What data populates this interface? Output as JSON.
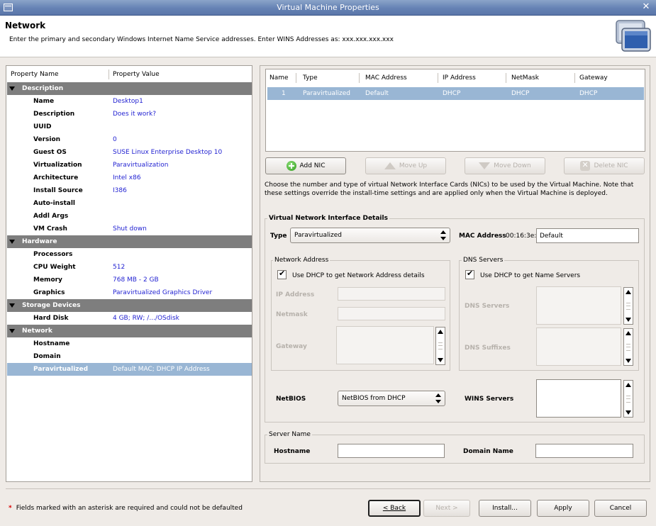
{
  "window": {
    "title": "Virtual Machine Properties"
  },
  "header": {
    "title": "Network",
    "subtitle": "Enter the primary and secondary Windows Internet Name Service addresses.  Enter WINS Addresses as: xxx.xxx.xxx.xxx"
  },
  "tree": {
    "col_name": "Property Name",
    "col_value": "Property Value",
    "rows": [
      {
        "type": "cat",
        "label": "Description"
      },
      {
        "type": "item",
        "name": "Name",
        "value": "Desktop1"
      },
      {
        "type": "item",
        "name": "Description",
        "value": "Does it work?"
      },
      {
        "type": "item",
        "name": "UUID",
        "value": ""
      },
      {
        "type": "item",
        "name": "Version",
        "value": "0"
      },
      {
        "type": "item",
        "name": "Guest OS",
        "value": "SUSE Linux Enterprise Desktop 10"
      },
      {
        "type": "item",
        "name": "Virtualization",
        "value": "Paravirtualization"
      },
      {
        "type": "item",
        "name": "Architecture",
        "value": "Intel x86"
      },
      {
        "type": "item",
        "name": "Install Source",
        "value": "I386"
      },
      {
        "type": "item",
        "name": "Auto-install",
        "value": ""
      },
      {
        "type": "item",
        "name": "Addl Args",
        "value": ""
      },
      {
        "type": "item",
        "name": "VM Crash",
        "value": "Shut down"
      },
      {
        "type": "cat",
        "label": "Hardware"
      },
      {
        "type": "item",
        "name": "Processors",
        "value": ""
      },
      {
        "type": "item",
        "name": "CPU Weight",
        "value": "512"
      },
      {
        "type": "item",
        "name": "Memory",
        "value": "768 MB - 2 GB"
      },
      {
        "type": "item",
        "name": "Graphics",
        "value": "Paravirtualized Graphics Driver"
      },
      {
        "type": "cat",
        "label": "Storage Devices"
      },
      {
        "type": "item",
        "name": "Hard Disk",
        "value": "4 GB; RW; /.../OSdisk"
      },
      {
        "type": "cat",
        "label": "Network"
      },
      {
        "type": "item",
        "name": "Hostname",
        "value": ""
      },
      {
        "type": "item",
        "name": "Domain",
        "value": ""
      },
      {
        "type": "item",
        "name": "Paravirtualized",
        "value": "Default MAC; DHCP IP Address",
        "selected": true
      }
    ]
  },
  "nic_table": {
    "headers": [
      "Name",
      "Type",
      "MAC Address",
      "IP Address",
      "NetMask",
      "Gateway"
    ],
    "row": [
      "1",
      "Paravirtualized",
      "Default",
      "DHCP",
      "DHCP",
      "DHCP"
    ]
  },
  "nic_buttons": {
    "add": "Add NIC",
    "move_up": "Move Up",
    "move_down": "Move Down",
    "delete": "Delete NIC"
  },
  "nic_help": "Choose the number and type of virtual Network Interface Cards (NICs) to be used by the Virtual Machine.  Note that these settings override the install-time settings and are applied only when the Virtual Machine is deployed.",
  "details": {
    "group_label": "Virtual Network Interface Details",
    "type_label": "Type",
    "type_value": "Paravirtualized",
    "mac_label": "MAC Address",
    "mac_prefix": "00:16:3e:",
    "mac_value": "Default",
    "network_address": {
      "label": "Network Address",
      "dhcp_check": "Use DHCP to get Network Address details",
      "ip_label": "IP Address",
      "netmask_label": "Netmask",
      "gateway_label": "Gateway"
    },
    "dns": {
      "label": "DNS Servers",
      "dhcp_check": "Use DHCP to get Name Servers",
      "servers_label": "DNS Servers",
      "suffixes_label": "DNS Suffixes"
    },
    "netbios_label": "NetBIOS",
    "netbios_value": "NetBIOS from DHCP",
    "wins_label": "WINS Servers"
  },
  "server_name": {
    "label": "Server Name",
    "hostname_label": "Hostname",
    "domain_label": "Domain Name"
  },
  "footer": {
    "required_star": "*",
    "required_text": "Fields marked with an asterisk are required and could not be defaulted",
    "back": "< Back",
    "next": "Next >",
    "install": "Install...",
    "apply": "Apply",
    "cancel": "Cancel"
  }
}
